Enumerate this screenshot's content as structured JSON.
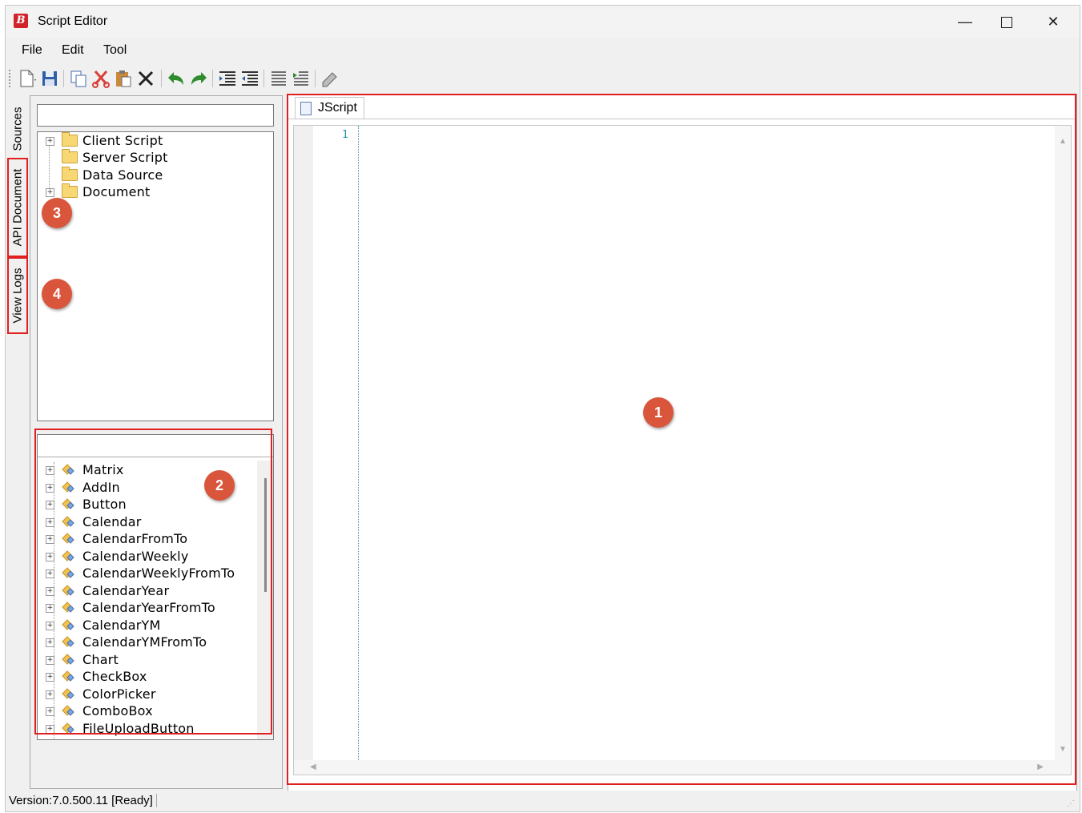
{
  "window": {
    "title": "Script Editor",
    "logo_letter": "B",
    "minimize": "—",
    "close": "✕"
  },
  "menu": {
    "items": [
      "File",
      "Edit",
      "Tool"
    ]
  },
  "toolbar": {
    "icons": [
      "new-icon",
      "save-icon",
      "copy-icon",
      "cut-icon",
      "paste-icon",
      "delete-icon",
      "undo-icon",
      "redo-icon",
      "indent-icon",
      "outdent-icon",
      "format-icon",
      "align-icon",
      "comment-icon"
    ]
  },
  "side_tabs": [
    "Sources",
    "API Document",
    "View Logs"
  ],
  "sources_tree": {
    "search_value": "",
    "items": [
      {
        "label": "Client Script",
        "expandable": true
      },
      {
        "label": "Server Script",
        "expandable": false
      },
      {
        "label": "Data Source",
        "expandable": false
      },
      {
        "label": "Document",
        "expandable": true
      }
    ]
  },
  "api_tree": {
    "search_value": "",
    "items": [
      "Matrix",
      "AddIn",
      "Button",
      "Calendar",
      "CalendarFromTo",
      "CalendarWeekly",
      "CalendarWeeklyFromTo",
      "CalendarYear",
      "CalendarYearFromTo",
      "CalendarYM",
      "CalendarYMFromTo",
      "Chart",
      "CheckBox",
      "ColorPicker",
      "ComboBox",
      "FileUploadButton"
    ]
  },
  "editor": {
    "tab_label": "JScript",
    "line_number": "1"
  },
  "status": {
    "text": "Version:7.0.500.11  [Ready]"
  },
  "markers": [
    "1",
    "2",
    "3",
    "4"
  ],
  "colors": {
    "marker": "#d9553b",
    "highlight": "#e02020",
    "line_number": "#2b91af",
    "logo": "#d2232a"
  }
}
